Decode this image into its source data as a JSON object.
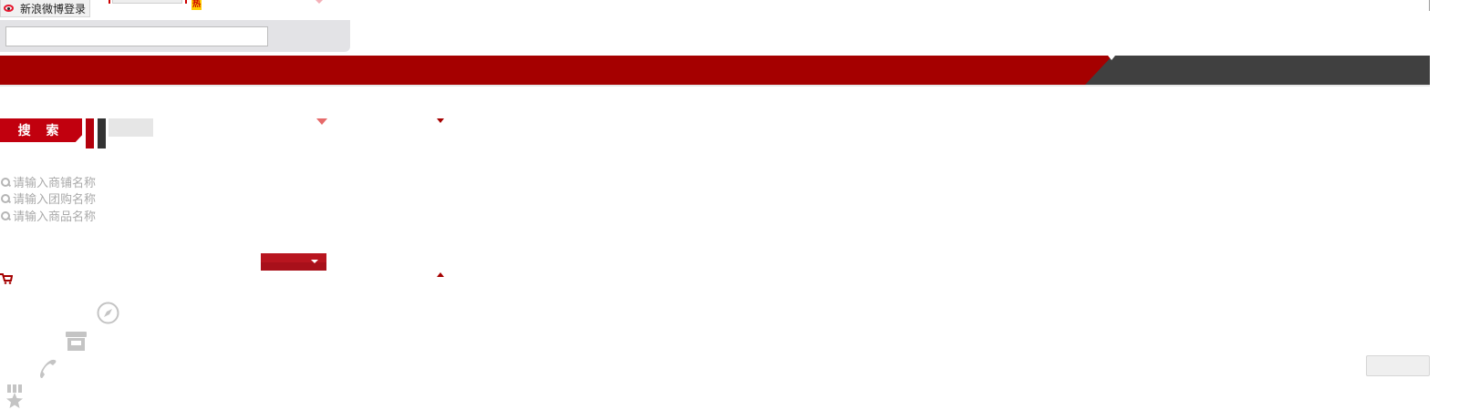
{
  "top_bar": {
    "weibo_login_label": "新浪微博登录",
    "hot_badge": "热"
  },
  "search": {
    "input_value": "",
    "button_label": "搜 索"
  },
  "search_hints": [
    {
      "icon": "search-icon",
      "text": "请输入商铺名称"
    },
    {
      "icon": "search-icon",
      "text": "请输入团购名称"
    },
    {
      "icon": "search-icon",
      "text": "请输入商品名称"
    }
  ],
  "colors": {
    "brand_red": "#a50000",
    "nav_dark": "#404040",
    "hint_grey": "#aaaaaa"
  },
  "icons": [
    "weibo-icon",
    "cart-icon",
    "compass-icon",
    "store-icon",
    "phone-icon",
    "medal-star-icon"
  ]
}
